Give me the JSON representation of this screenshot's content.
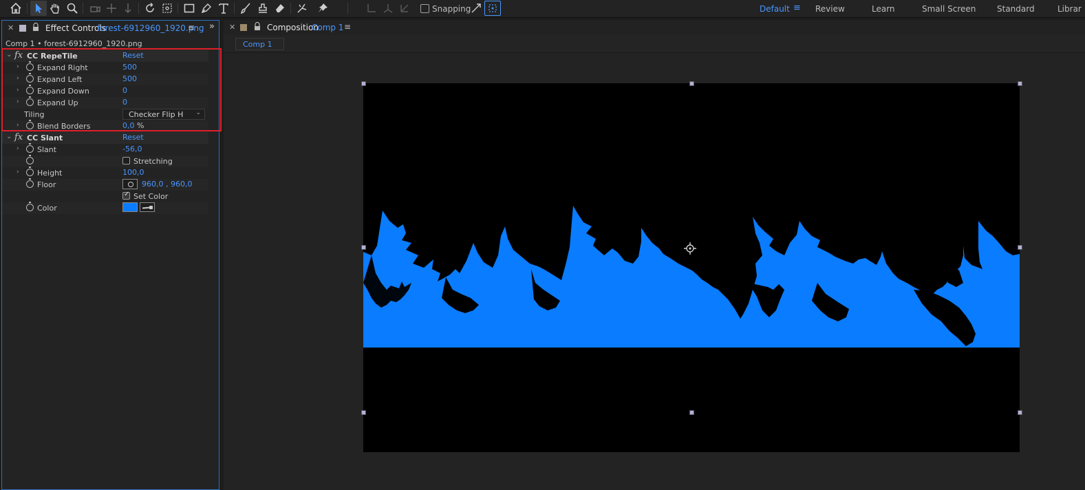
{
  "toolbar": {
    "tools": [
      "home-icon",
      "selection-tool-icon",
      "hand-tool-icon",
      "zoom-tool-icon",
      "orbit-camera-icon",
      "pan-camera-icon",
      "dolly-camera-icon",
      "rotate-tool-icon",
      "pan-behind-tool-icon",
      "rectangle-tool-icon",
      "pen-tool-icon",
      "type-tool-icon",
      "brush-tool-icon",
      "clone-stamp-tool-icon",
      "eraser-tool-icon",
      "roto-brush-tool-icon",
      "puppet-pin-tool-icon"
    ],
    "snapping_label": "Snapping",
    "snapping_checked": false,
    "workspaces": [
      "Default",
      "Review",
      "Learn",
      "Small Screen",
      "Standard",
      "Librar"
    ],
    "active_workspace": "Default",
    "accent_color": "#4a97ff"
  },
  "effect_controls": {
    "tab_title": "Effect Controls",
    "tab_file": "forest-6912960_1920.png",
    "breadcrumb": "Comp 1 • forest-6912960_1920.png",
    "repetile": {
      "name": "CC RepeTile",
      "reset": "Reset",
      "expand_right_label": "Expand Right",
      "expand_right": "500",
      "expand_left_label": "Expand Left",
      "expand_left": "500",
      "expand_down_label": "Expand Down",
      "expand_down": "0",
      "expand_up_label": "Expand Up",
      "expand_up": "0",
      "tiling_label": "Tiling",
      "tiling": "Checker Flip H",
      "blend_borders_label": "Blend Borders",
      "blend_borders": "0,0",
      "blend_borders_unit": "%"
    },
    "slant": {
      "name": "CC Slant",
      "reset": "Reset",
      "slant_label": "Slant",
      "slant": "-56,0",
      "stretching_label": "Stretching",
      "stretching_checked": false,
      "height_label": "Height",
      "height": "100,0",
      "floor_label": "Floor",
      "floor": "960,0 , 960,0",
      "set_color_label": "Set Color",
      "set_color_checked": true,
      "color_label": "Color",
      "color": "#0a7cff"
    }
  },
  "composition": {
    "tab_title": "Composition",
    "comp_name": "Comp 1",
    "subtab": "Comp 1",
    "layer_color": "#0a7cff",
    "background_color": "#000000"
  }
}
